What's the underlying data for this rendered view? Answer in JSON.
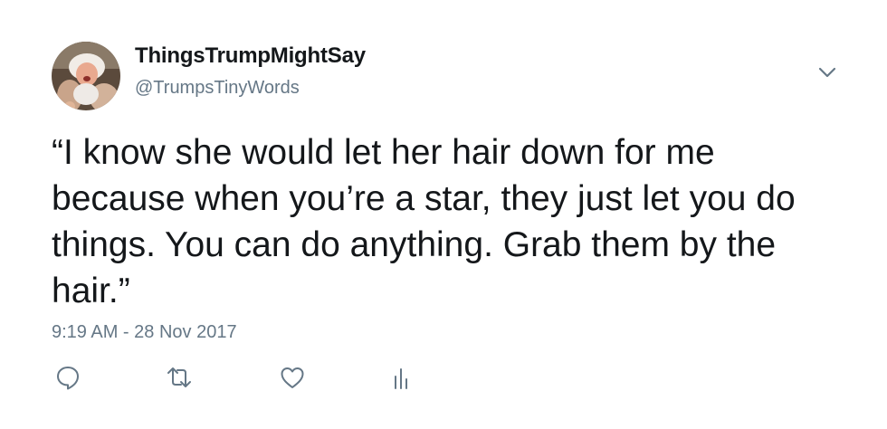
{
  "tweet": {
    "author": {
      "display_name": "ThingsTrumpMightSay",
      "handle": "@TrumpsTinyWords"
    },
    "text": "“I know she would let her hair down for me because when you’re a star, they just let you do things. You can do anything. Grab them by the hair.”",
    "timestamp": "9:19 AM - 28 Nov 2017"
  },
  "icons": {
    "menu": "chevron-down-icon",
    "reply": "reply-icon",
    "retweet": "retweet-icon",
    "like": "heart-icon",
    "analytics": "analytics-icon"
  },
  "colors": {
    "text_primary": "#14171a",
    "text_secondary": "#657786",
    "icon": "#657786",
    "background": "#ffffff"
  }
}
